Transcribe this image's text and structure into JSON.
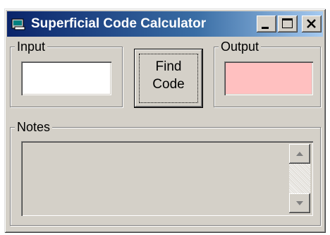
{
  "window": {
    "title": "Superficial Code Calculator"
  },
  "input_group": {
    "label": "Input",
    "value": ""
  },
  "find_button": {
    "line1": "Find",
    "line2": "Code"
  },
  "output_group": {
    "label": "Output",
    "value": "",
    "background": "#ffc0c0"
  },
  "notes_group": {
    "label": "Notes",
    "text": ""
  },
  "icons": [
    "app-icon",
    "minimize-icon",
    "maximize-icon",
    "close-icon",
    "scroll-up-arrow-icon",
    "scroll-down-arrow-icon"
  ]
}
